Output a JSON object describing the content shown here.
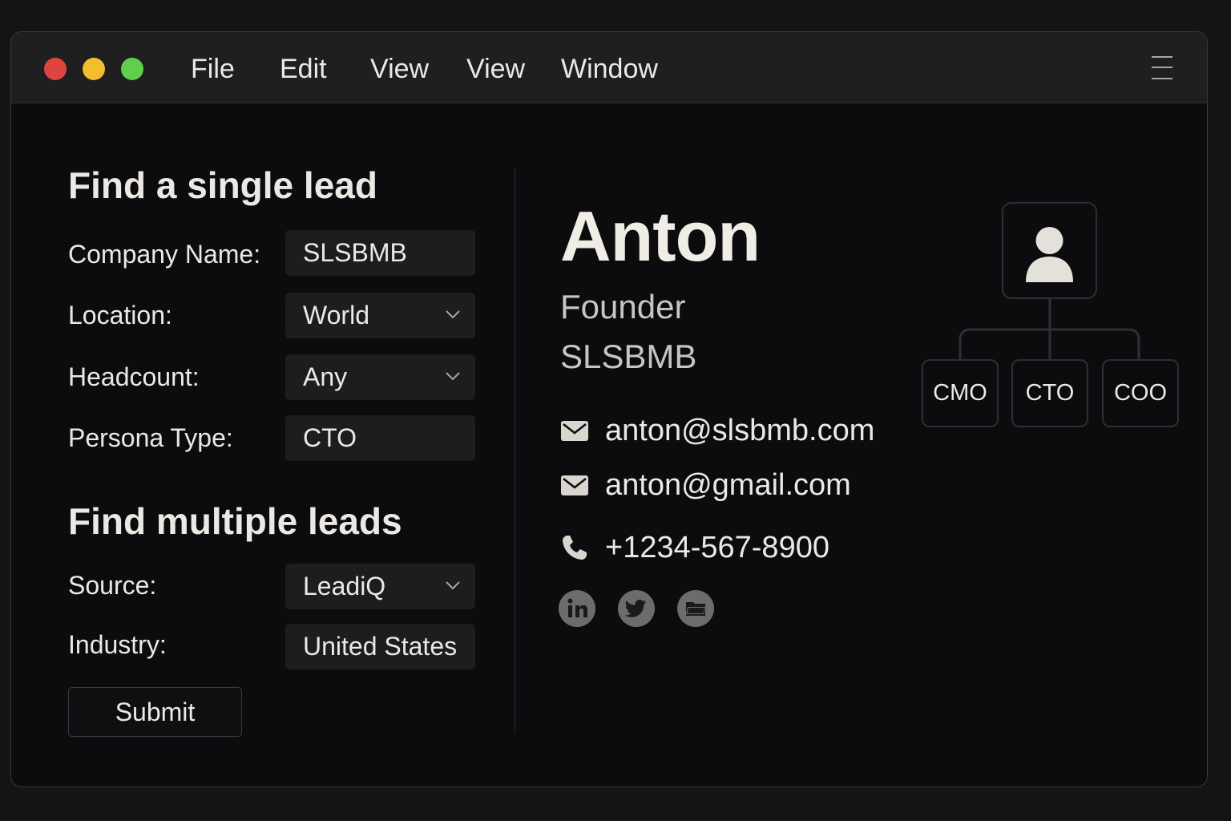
{
  "window": {
    "menu": [
      "File",
      "Edit",
      "View",
      "View",
      "Window"
    ],
    "traffic_lights": {
      "close": "#e0443e",
      "minimize": "#f3bd2e",
      "zoom": "#5fcf4c"
    }
  },
  "single_lead": {
    "title": "Find a single lead",
    "fields": [
      {
        "label": "Company Name:",
        "value": "SLSBMB",
        "type": "text"
      },
      {
        "label": "Location:",
        "value": "World",
        "type": "select"
      },
      {
        "label": "Headcount:",
        "value": "Any",
        "type": "select"
      },
      {
        "label": "Persona Type:",
        "value": "CTO",
        "type": "text"
      }
    ]
  },
  "multiple_leads": {
    "title": "Find multiple leads",
    "fields": [
      {
        "label": "Source:",
        "value": "LeadiQ",
        "type": "select"
      },
      {
        "label": "Industry:",
        "value": "United States",
        "type": "text"
      }
    ],
    "submit_label": "Submit"
  },
  "profile": {
    "name": "Anton",
    "role": "Founder",
    "company": "SLSBMB",
    "contacts": [
      {
        "icon": "mail-icon",
        "text": "anton@slsbmb.com"
      },
      {
        "icon": "mail-icon",
        "text": "anton@gmail.com"
      },
      {
        "icon": "phone-icon",
        "text": "+1234-567-8900"
      }
    ],
    "socials": [
      "linkedin-icon",
      "twitter-icon",
      "folder-icon"
    ]
  },
  "org_chart": {
    "root_icon": "person-icon",
    "children": [
      "CMO",
      "CTO",
      "COO"
    ]
  }
}
